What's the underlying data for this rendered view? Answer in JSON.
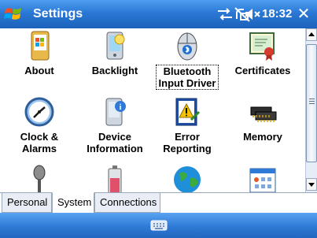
{
  "titlebar": {
    "title": "Settings",
    "clock": "18:32",
    "close_label": "✕"
  },
  "apps": [
    {
      "label_lines": [
        "About"
      ],
      "icon": "windows-device-icon"
    },
    {
      "label_lines": [
        "Backlight"
      ],
      "icon": "backlight-icon"
    },
    {
      "label_lines": [
        "Bluetooth",
        "Input Driver"
      ],
      "icon": "bluetooth-mouse-icon",
      "selected": true
    },
    {
      "label_lines": [
        "Certificates"
      ],
      "icon": "certificate-icon"
    },
    {
      "label_lines": [
        "Clock &",
        "Alarms"
      ],
      "icon": "clock-icon"
    },
    {
      "label_lines": [
        "Device",
        "Information"
      ],
      "icon": "device-info-icon"
    },
    {
      "label_lines": [
        "Error",
        "Reporting"
      ],
      "icon": "error-reporting-icon"
    },
    {
      "label_lines": [
        "Memory"
      ],
      "icon": "memory-chip-icon"
    },
    {
      "label_lines": [],
      "icon": "microphone-icon"
    },
    {
      "label_lines": [],
      "icon": "battery-icon"
    },
    {
      "label_lines": [],
      "icon": "globe-icon"
    },
    {
      "label_lines": [],
      "icon": "window-grid-icon"
    }
  ],
  "tabs": [
    {
      "label": "Personal",
      "active": false
    },
    {
      "label": "System",
      "active": true
    },
    {
      "label": "Connections",
      "active": false
    }
  ],
  "colors": {
    "titlebar": "#2a78d4",
    "bottombar": "#2f7ad6"
  }
}
